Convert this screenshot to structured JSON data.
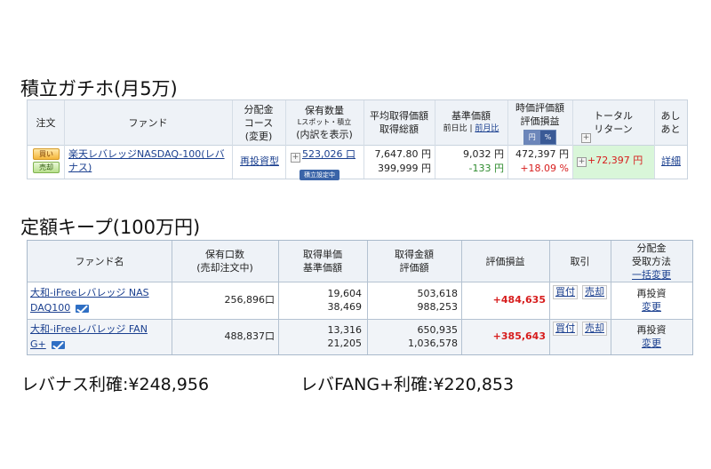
{
  "section1": {
    "title": "積立ガチホ(月5万)",
    "headers": {
      "order": "注文",
      "fund": "ファンド",
      "dist": [
        "分配金",
        "コース",
        "(変更)"
      ],
      "holdings": [
        "保有数量",
        "Lスポット・積立",
        "(内訳を表示)"
      ],
      "avg_cost": [
        "平均取得価額",
        "取得総額"
      ],
      "base_price": [
        "基準価額"
      ],
      "base_price_sub": "前日比",
      "base_price_sub_link": "前月比",
      "value": [
        "時価評価額",
        "評価損益"
      ],
      "toggle": [
        "円",
        "%"
      ],
      "total_return": [
        "トータル",
        "リターン"
      ],
      "history": [
        "あし",
        "あと"
      ]
    },
    "row": {
      "buy_label": "買い",
      "sell_label": "売却",
      "fund_name": "楽天レバレッジNASDAQ-100(レバナス)",
      "dist_course": "再投資型",
      "quantity": "523,026 口",
      "accumulation_badge": "積立設定中",
      "avg_price": "7,647.80 円",
      "total_cost": "399,999 円",
      "base_price": "9,032 円",
      "day_change": "-133 円",
      "market_value": "472,397 円",
      "pnl_pct": "+18.09 %",
      "total_return": "+72,397 円",
      "detail_link": "詳細"
    }
  },
  "section2": {
    "title": "定額キープ(100万円)",
    "headers": {
      "fund_name": "ファンド名",
      "holdings": [
        "保有口数",
        "(売却注文中)"
      ],
      "unit_price": [
        "取得単価",
        "基準価額"
      ],
      "amount": [
        "取得金額",
        "評価額"
      ],
      "pnl": "評価損益",
      "trade": "取引",
      "dist": "分配金",
      "dist2": "受取方法",
      "bulk_change": "一括変更"
    },
    "rows": [
      {
        "fund_line1": "大和-iFreeレバレッジ NAS",
        "fund_line2": "DAQ100",
        "units": "256,896口",
        "cost_unit": "19,604",
        "base_price": "38,469",
        "cost_amount": "503,618",
        "value": "988,253",
        "pnl": "+484,635",
        "buy": "買付",
        "sell": "売却",
        "method": "再投資",
        "change": "変更"
      },
      {
        "fund_line1": "大和-iFreeレバレッジ FAN",
        "fund_line2": "G+",
        "units": "488,837口",
        "cost_unit": "13,316",
        "base_price": "21,205",
        "cost_amount": "650,935",
        "value": "1,036,578",
        "pnl": "+385,643",
        "buy": "買付",
        "sell": "売却",
        "method": "再投資",
        "change": "変更"
      }
    ]
  },
  "summary": {
    "levanas": "レバナス利確:¥248,956",
    "fang": "レバFANG+利確:¥220,853"
  },
  "colors": {
    "header_bg": "#eef2f7",
    "total_return_bg": "#d9f6d9",
    "gain_red": "#d71d1d",
    "loss_green": "#2e8b2e",
    "link_blue": "#1a3f8f"
  },
  "icons": [
    "plus-icon",
    "mail-icon"
  ]
}
